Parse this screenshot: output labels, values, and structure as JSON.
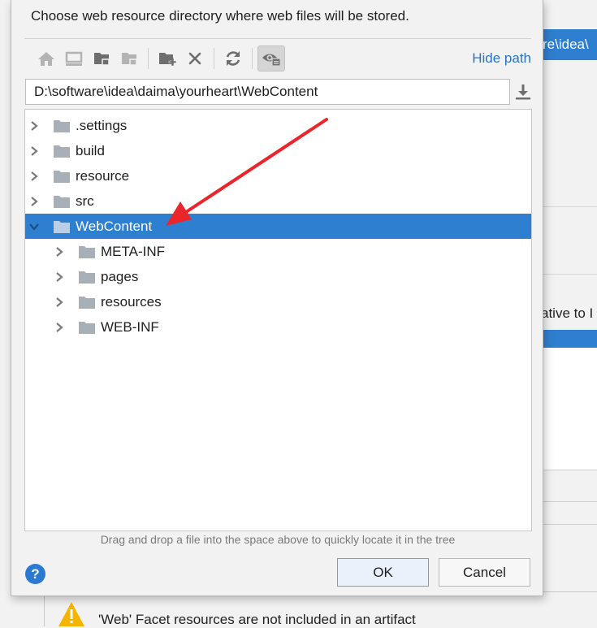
{
  "background": {
    "path_fragment": "re\\idea\\",
    "relative_fragment": "ative to I",
    "warning_text": "'Web' Facet resources are not included in an artifact"
  },
  "dialog": {
    "instruction": "Choose web resource directory where web files will be stored.",
    "toolbar": {
      "icons": [
        "home-icon",
        "desktop-icon",
        "project-folder-icon",
        "module-folder-icon",
        "new-folder-icon",
        "delete-icon",
        "refresh-icon",
        "show-hidden-icon"
      ],
      "hide_path_label": "Hide path"
    },
    "path_value": "D:\\software\\idea\\daima\\yourheart\\WebContent",
    "tree": [
      {
        "label": ".settings",
        "level": 0,
        "expanded": false,
        "selected": false
      },
      {
        "label": "build",
        "level": 0,
        "expanded": false,
        "selected": false
      },
      {
        "label": "resource",
        "level": 0,
        "expanded": false,
        "selected": false
      },
      {
        "label": "src",
        "level": 0,
        "expanded": false,
        "selected": false
      },
      {
        "label": "WebContent",
        "level": 0,
        "expanded": true,
        "selected": true
      },
      {
        "label": "META-INF",
        "level": 1,
        "expanded": false,
        "selected": false
      },
      {
        "label": "pages",
        "level": 1,
        "expanded": false,
        "selected": false
      },
      {
        "label": "resources",
        "level": 1,
        "expanded": false,
        "selected": false
      },
      {
        "label": "WEB-INF",
        "level": 1,
        "expanded": false,
        "selected": false
      }
    ],
    "drag_hint": "Drag and drop a file into the space above to quickly locate it in the tree",
    "help_label": "?",
    "ok_label": "OK",
    "cancel_label": "Cancel"
  },
  "colors": {
    "selection": "#2f7fd0",
    "link": "#2874c6",
    "annotation_arrow": "#e8262b",
    "warning": "#f4b400"
  }
}
